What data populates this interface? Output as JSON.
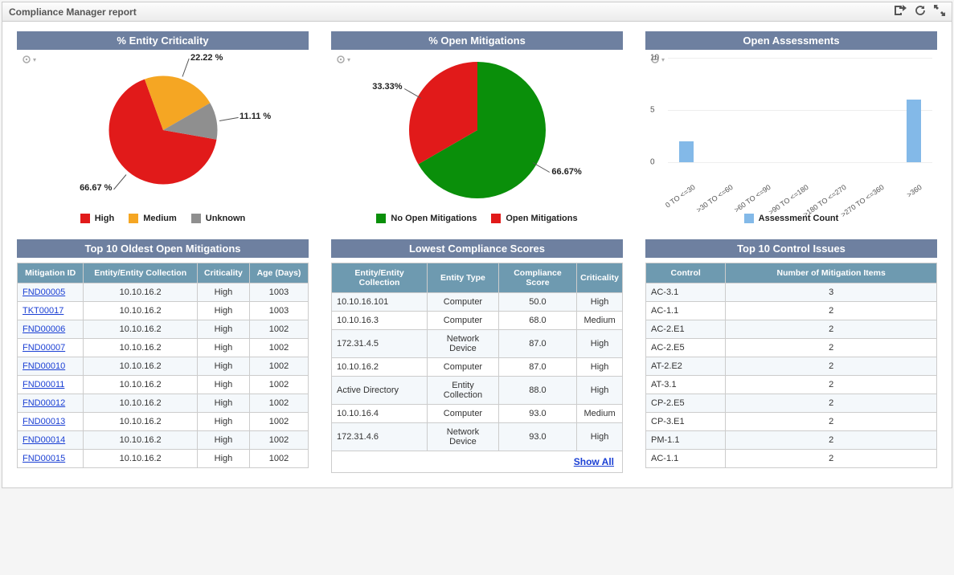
{
  "window": {
    "title": "Compliance Manager report"
  },
  "panels": {
    "entity_criticality": {
      "title": "% Entity Criticality"
    },
    "open_mitigations_chart": {
      "title": "% Open Mitigations"
    },
    "open_assessments": {
      "title": "Open Assessments"
    },
    "oldest_mitigations": {
      "title": "Top 10 Oldest Open Mitigations"
    },
    "lowest_compliance": {
      "title": "Lowest Compliance Scores"
    },
    "control_issues": {
      "title": "Top 10 Control Issues"
    }
  },
  "chart_data": [
    {
      "id": "entity_criticality",
      "type": "pie",
      "title": "% Entity Criticality",
      "series": [
        {
          "name": "High",
          "value": 66.67,
          "label": "66.67 %",
          "color": "#e11a1a"
        },
        {
          "name": "Medium",
          "value": 22.22,
          "label": "22.22 %",
          "color": "#f5a623"
        },
        {
          "name": "Unknown",
          "value": 11.11,
          "label": "11.11 %",
          "color": "#8f8f8f"
        }
      ],
      "legend": [
        "High",
        "Medium",
        "Unknown"
      ]
    },
    {
      "id": "open_mitigations",
      "type": "pie",
      "title": "% Open Mitigations",
      "series": [
        {
          "name": "No Open Mitigations",
          "value": 66.67,
          "label": "66.67%",
          "color": "#0a8f0a"
        },
        {
          "name": "Open Mitigations",
          "value": 33.33,
          "label": "33.33%",
          "color": "#e11a1a"
        }
      ],
      "legend": [
        "No Open Mitigations",
        "Open Mitigations"
      ]
    },
    {
      "id": "open_assessments",
      "type": "bar",
      "title": "Open Assessments",
      "categories": [
        "0 TO <=30",
        ">30 TO <=60",
        ">60 TO <=90",
        ">90 TO <=180",
        ">180 TO <=270",
        ">270 TO <=360",
        ">360"
      ],
      "series": [
        {
          "name": "Assessment Count",
          "values": [
            2,
            0,
            0,
            0,
            0,
            0,
            6
          ],
          "color": "#83b9e8"
        }
      ],
      "ylim": [
        0,
        10
      ],
      "yticks": [
        0,
        5,
        10
      ],
      "legend": [
        "Assessment Count"
      ]
    }
  ],
  "tables": {
    "oldest_mitigations": {
      "columns": [
        "Mitigation ID",
        "Entity/Entity Collection",
        "Criticality",
        "Age (Days)"
      ],
      "rows": [
        {
          "id": "FND00005",
          "entity": "10.10.16.2",
          "crit": "High",
          "age": "1003"
        },
        {
          "id": "TKT00017",
          "entity": "10.10.16.2",
          "crit": "High",
          "age": "1003"
        },
        {
          "id": "FND00006",
          "entity": "10.10.16.2",
          "crit": "High",
          "age": "1002"
        },
        {
          "id": "FND00007",
          "entity": "10.10.16.2",
          "crit": "High",
          "age": "1002"
        },
        {
          "id": "FND00010",
          "entity": "10.10.16.2",
          "crit": "High",
          "age": "1002"
        },
        {
          "id": "FND00011",
          "entity": "10.10.16.2",
          "crit": "High",
          "age": "1002"
        },
        {
          "id": "FND00012",
          "entity": "10.10.16.2",
          "crit": "High",
          "age": "1002"
        },
        {
          "id": "FND00013",
          "entity": "10.10.16.2",
          "crit": "High",
          "age": "1002"
        },
        {
          "id": "FND00014",
          "entity": "10.10.16.2",
          "crit": "High",
          "age": "1002"
        },
        {
          "id": "FND00015",
          "entity": "10.10.16.2",
          "crit": "High",
          "age": "1002"
        }
      ]
    },
    "lowest_compliance": {
      "columns": [
        "Entity/Entity Collection",
        "Entity Type",
        "Compliance Score",
        "Criticality"
      ],
      "rows": [
        {
          "entity": "10.10.16.101",
          "type": "Computer",
          "score": "50.0",
          "crit": "High"
        },
        {
          "entity": "10.10.16.3",
          "type": "Computer",
          "score": "68.0",
          "crit": "Medium"
        },
        {
          "entity": "172.31.4.5",
          "type": "Network Device",
          "score": "87.0",
          "crit": "High"
        },
        {
          "entity": "10.10.16.2",
          "type": "Computer",
          "score": "87.0",
          "crit": "High"
        },
        {
          "entity": "Active Directory",
          "type": "Entity Collection",
          "score": "88.0",
          "crit": "High"
        },
        {
          "entity": "10.10.16.4",
          "type": "Computer",
          "score": "93.0",
          "crit": "Medium"
        },
        {
          "entity": "172.31.4.6",
          "type": "Network Device",
          "score": "93.0",
          "crit": "High"
        }
      ],
      "show_all": "Show All"
    },
    "control_issues": {
      "columns": [
        "Control",
        "Number of Mitigation Items"
      ],
      "rows": [
        {
          "control": "AC-3.1",
          "count": "3"
        },
        {
          "control": "AC-1.1",
          "count": "2"
        },
        {
          "control": "AC-2.E1",
          "count": "2"
        },
        {
          "control": "AC-2.E5",
          "count": "2"
        },
        {
          "control": "AT-2.E2",
          "count": "2"
        },
        {
          "control": "AT-3.1",
          "count": "2"
        },
        {
          "control": "CP-2.E5",
          "count": "2"
        },
        {
          "control": "CP-3.E1",
          "count": "2"
        },
        {
          "control": "PM-1.1",
          "count": "2"
        },
        {
          "control": "AC-1.1",
          "count": "2"
        }
      ]
    }
  }
}
